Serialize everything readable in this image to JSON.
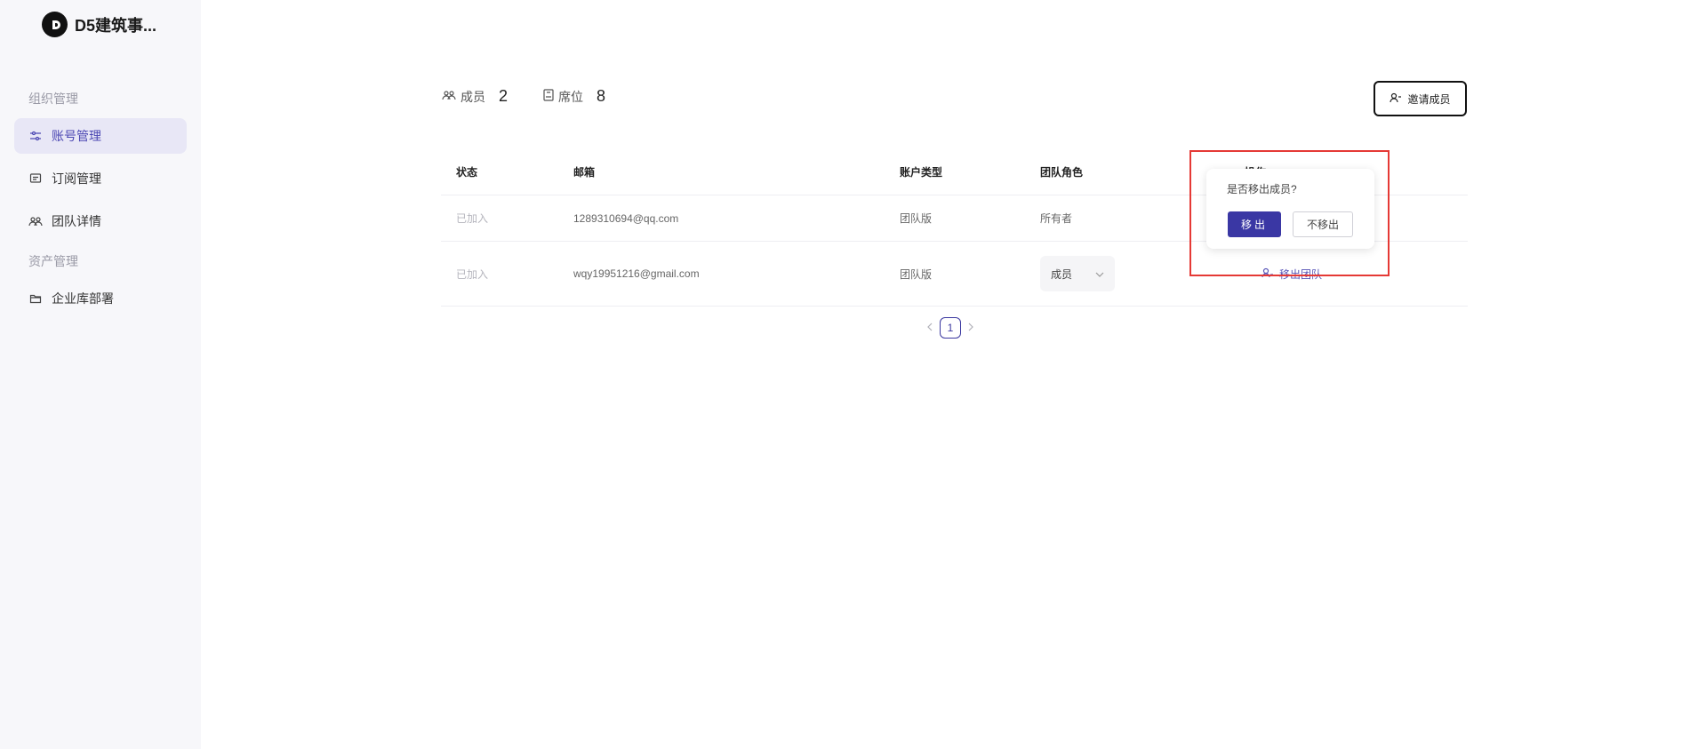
{
  "brand": {
    "name": "D5建筑事...",
    "logo_icon": "d5-logo-icon"
  },
  "sidebar": {
    "section_org": "组织管理",
    "items": [
      {
        "label": "账号管理",
        "icon": "sliders-icon",
        "active": true
      },
      {
        "label": "订阅管理",
        "icon": "subscription-icon",
        "active": false
      },
      {
        "label": "团队详情",
        "icon": "team-icon",
        "active": false
      }
    ],
    "section_assets": "资产管理",
    "assets_items": [
      {
        "label": "企业库部署",
        "icon": "folder-icon"
      }
    ]
  },
  "stats": {
    "members_label": "成员",
    "members_count": "2",
    "seats_label": "席位",
    "seats_count": "8"
  },
  "invite_button": {
    "label": "邀请成员"
  },
  "table": {
    "headers": [
      "状态",
      "邮箱",
      "账户类型",
      "团队角色",
      "操作"
    ],
    "rows": [
      {
        "status": "已加入",
        "email": "1289310694@qq.com",
        "account_type": "团队版",
        "role": "所有者"
      },
      {
        "status": "已加入",
        "email": "wqy19951216@gmail.com",
        "account_type": "团队版",
        "role": "成员",
        "action": "移出团队"
      }
    ]
  },
  "pagination": {
    "current": "1"
  },
  "popconfirm": {
    "title": "是否移出成员?",
    "confirm_label": "移出",
    "cancel_label": "不移出"
  },
  "colors": {
    "accent": "#3a37a4",
    "highlight": "#e53935",
    "sidebar_active_bg": "#e8e7f6"
  }
}
